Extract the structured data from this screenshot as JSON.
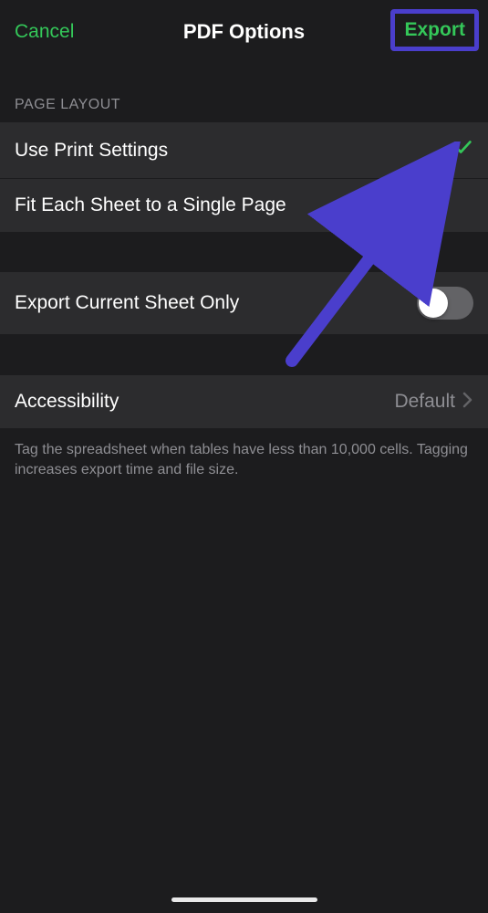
{
  "header": {
    "cancel": "Cancel",
    "title": "PDF Options",
    "export": "Export"
  },
  "sections": {
    "pageLayout": {
      "title": "PAGE LAYOUT",
      "usePrintSettings": "Use Print Settings",
      "fitEachSheet": "Fit Each Sheet to a Single Page"
    },
    "exportCurrent": "Export Current Sheet Only",
    "accessibility": {
      "label": "Accessibility",
      "value": "Default"
    },
    "footerText": "Tag the spreadsheet when tables have less than 10,000 cells. Tagging increases export time and file size."
  },
  "annotation": {
    "arrowColor": "#4a3ecc",
    "highlightColor": "#4a3ecc"
  }
}
